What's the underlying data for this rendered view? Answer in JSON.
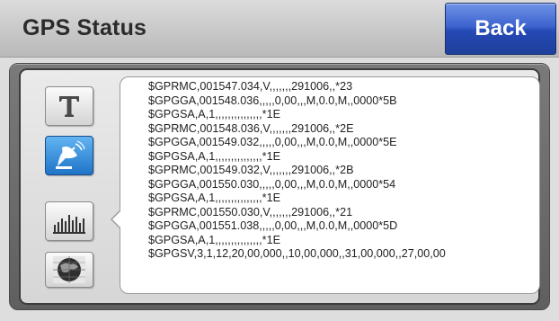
{
  "header": {
    "title": "GPS Status",
    "back_label": "Back"
  },
  "toolbar": {
    "items": [
      {
        "name": "text",
        "icon": "text-t-icon",
        "active": false
      },
      {
        "name": "satellite",
        "icon": "satellite-dish-icon",
        "active": true
      },
      {
        "name": "signal",
        "icon": "signal-bars-icon",
        "active": false
      },
      {
        "name": "map",
        "icon": "globe-map-icon",
        "active": false
      }
    ],
    "active_color": "#2a86d8"
  },
  "nmea_log": {
    "lines": [
      "$GPRMC,001547.034,V,,,,,,,291006,,*23",
      "$GPGGA,001548.036,,,,,0,00,,,M,0.0,M,,0000*5B",
      "$GPGSA,A,1,,,,,,,,,,,,,,,*1E",
      "$GPRMC,001548.036,V,,,,,,,291006,,*2E",
      "$GPGGA,001549.032,,,,,0,00,,,M,0.0,M,,0000*5E",
      "$GPGSA,A,1,,,,,,,,,,,,,,,*1E",
      "$GPRMC,001549.032,V,,,,,,,291006,,*2B",
      "$GPGGA,001550.030,,,,,0,00,,,M,0.0,M,,0000*54",
      "$GPGSA,A,1,,,,,,,,,,,,,,,*1E",
      "$GPRMC,001550.030,V,,,,,,,291006,,*21",
      "$GPGGA,001551.038,,,,,0,00,,,M,0.0,M,,0000*5D",
      "$GPGSA,A,1,,,,,,,,,,,,,,,*1E",
      "$GPGSV,3,1,12,20,00,000,,10,00,000,,31,00,000,,27,00,00"
    ]
  }
}
